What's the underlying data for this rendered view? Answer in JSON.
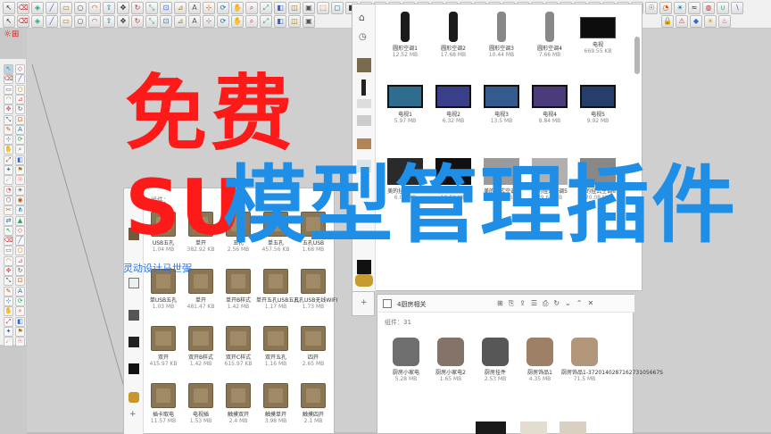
{
  "overlay": {
    "title_free": "免费",
    "title_su": "SU",
    "title_rest": "模型管理插件",
    "watermark": "灵动设计马世弼"
  },
  "colors": {
    "red": "#ff1a1a",
    "blue": "#1e8ee6"
  },
  "top_toolbar": {
    "icons": [
      "select-icon",
      "eraser-icon",
      "paint-icon",
      "line-icon",
      "rect-icon",
      "circle-icon",
      "arc-icon",
      "pushpull-icon",
      "move-icon",
      "rotate-icon",
      "scale-icon",
      "offset-icon",
      "tape-icon",
      "text-icon",
      "axes-icon",
      "orbit-icon",
      "pan-icon",
      "zoom-icon",
      "zoom-extents-icon",
      "section-icon",
      "xray-icon",
      "back-edges-icon",
      "wireframe-icon",
      "hidden-line-icon",
      "shaded-icon",
      "textured-icon",
      "monochrome-icon",
      "iso-icon",
      "top-icon",
      "front-icon",
      "right-icon",
      "back-icon",
      "left-icon",
      "bottom-icon",
      "component-icon",
      "group-icon",
      "layers-icon",
      "styles-icon",
      "warehouse-icon",
      "extension-icon",
      "ruby-icon",
      "plugin-icon",
      "camera-icon",
      "walk-icon",
      "look-icon",
      "position-icon",
      "fog-icon",
      "shadow-icon",
      "sandbox-icon",
      "solid-icon",
      "union-icon",
      "subtract-icon",
      "trim-icon",
      "split-icon"
    ],
    "right_icons": [
      "lock-icon",
      "warning-icon",
      "cube-icon",
      "sun-icon",
      "fire-icon"
    ]
  },
  "left_panel": {
    "count": "组件：",
    "items": [
      {
        "name": "USB五孔",
        "size": "1.04 MB"
      },
      {
        "name": "单开",
        "size": "382.92 KB"
      },
      {
        "name": "五孔",
        "size": "2.56 MB"
      },
      {
        "name": "单五孔",
        "size": "457.56 KB"
      },
      {
        "name": "五孔USB",
        "size": "1.68 MB"
      },
      {
        "name": "单USB五孔",
        "size": "1.03 MB"
      },
      {
        "name": "单开",
        "size": "481.47 KB"
      },
      {
        "name": "单开B样式",
        "size": "1.42 MB"
      },
      {
        "name": "单开五孔USB五孔",
        "size": "1.17 MB"
      },
      {
        "name": "五孔USB无线WIFI",
        "size": "1.73 MB"
      },
      {
        "name": "双开",
        "size": "415.97 KB"
      },
      {
        "name": "双开B样式",
        "size": "1.42 MB"
      },
      {
        "name": "双开C样式",
        "size": "615.97 KB"
      },
      {
        "name": "双开五孔",
        "size": "1.16 MB"
      },
      {
        "name": "四开",
        "size": "2.65 MB"
      },
      {
        "name": "插卡取电",
        "size": "11.57 MB"
      },
      {
        "name": "电视插",
        "size": "1.53 MB"
      },
      {
        "name": "触摸双开",
        "size": "2.4 MB"
      },
      {
        "name": "触摸单开",
        "size": "3.98 MB"
      },
      {
        "name": "触摸四开",
        "size": "2.1 MB"
      }
    ]
  },
  "right_panel": {
    "items": [
      {
        "name": "圆形空调1",
        "size": "12.52 MB"
      },
      {
        "name": "圆形空调2",
        "size": "17.68 MB"
      },
      {
        "name": "圆形空调3",
        "size": "10.44 MB"
      },
      {
        "name": "圆形空调4",
        "size": "7.66 MB"
      },
      {
        "name": "电视",
        "size": "669.55 KB"
      },
      {
        "name": "电视1",
        "size": "5.97 MB"
      },
      {
        "name": "电视2",
        "size": "6.32 MB"
      },
      {
        "name": "电视3",
        "size": "13.5 MB"
      },
      {
        "name": "电视4",
        "size": "8.84 MB"
      },
      {
        "name": "电视5",
        "size": "9.92 MB"
      },
      {
        "name": "",
        "size": "6.08 MB"
      },
      {
        "name": "",
        "size": "10.51 MB"
      },
      {
        "name": "",
        "size": "9.91 MB"
      },
      {
        "name": "",
        "size": "29.64 MB"
      },
      {
        "name": "",
        "size": "20.08 MB"
      }
    ],
    "row3_names": [
      "美的挂式空调2",
      "美的挂式空调3",
      "美的挂式空调4",
      "美的挂式空调5",
      "美的挂式空调6"
    ]
  },
  "bottom_panel": {
    "title": "4厨房相关",
    "count_label": "组件：31",
    "items": [
      {
        "name": "厨房小家电",
        "size": "5.28 MB"
      },
      {
        "name": "厨房小家电2",
        "size": "1.65 MB"
      },
      {
        "name": "厨房挂件",
        "size": "2.53 MB"
      },
      {
        "name": "厨房饰品1",
        "size": "4.35 MB"
      },
      {
        "name": "厨房饰品1-372014028716273105667S",
        "size": "71.5 MB"
      }
    ]
  }
}
